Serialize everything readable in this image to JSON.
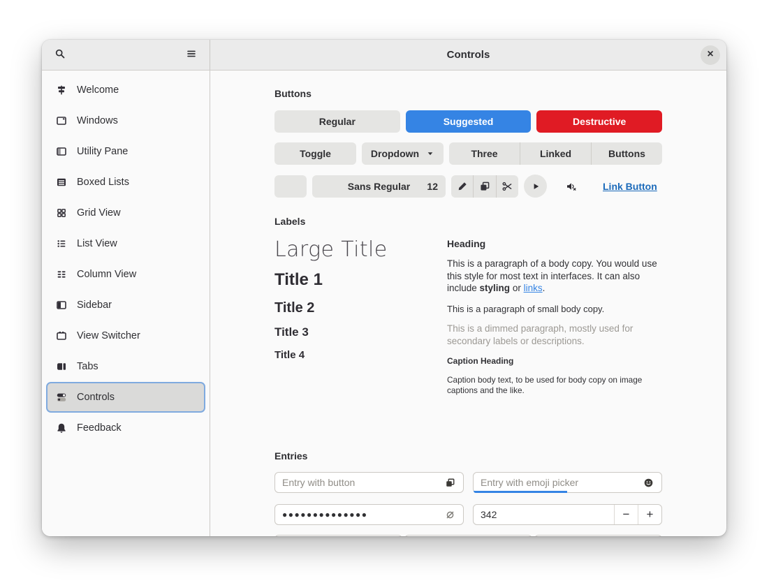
{
  "window": {
    "title": "Controls"
  },
  "titlebar": {
    "close_glyph": "×",
    "icons": [
      "search-icon",
      "hamburger-menu-icon",
      "close-icon"
    ]
  },
  "sidebar": {
    "selected": "Controls",
    "items": [
      {
        "label": "Welcome",
        "icon": "signpost-icon"
      },
      {
        "label": "Windows",
        "icon": "window-icon"
      },
      {
        "label": "Utility Pane",
        "icon": "utility-pane-icon"
      },
      {
        "label": "Boxed Lists",
        "icon": "boxed-lists-icon"
      },
      {
        "label": "Grid View",
        "icon": "grid-view-icon"
      },
      {
        "label": "List View",
        "icon": "list-view-icon"
      },
      {
        "label": "Column View",
        "icon": "column-view-icon"
      },
      {
        "label": "Sidebar",
        "icon": "sidebar-panel-icon"
      },
      {
        "label": "View Switcher",
        "icon": "view-switcher-icon"
      },
      {
        "label": "Tabs",
        "icon": "tabs-icon"
      },
      {
        "label": "Controls",
        "icon": "switch-icon"
      },
      {
        "label": "Feedback",
        "icon": "bell-icon"
      }
    ]
  },
  "sections": {
    "buttons": {
      "heading": "Buttons",
      "regular": "Regular",
      "suggested": "Suggested",
      "destructive": "Destructive",
      "toggle": "Toggle",
      "dropdown": "Dropdown",
      "linked": [
        "Three",
        "Linked",
        "Buttons"
      ],
      "font_name": "Sans Regular",
      "font_size": "12",
      "toolbar_icons": [
        "edit-pencil-icon",
        "copy-icon",
        "cut-scissors-icon",
        "play-icon",
        "volume-muted-icon"
      ],
      "link_button": "Link Button"
    },
    "labels": {
      "heading": "Labels",
      "large_title": "Large Title",
      "title1": "Title 1",
      "title2": "Title 2",
      "title3": "Title 3",
      "title4": "Title 4",
      "demo_heading": "Heading",
      "body_p1": "This is a paragraph of a body copy. You would use this style for most text in interfaces. It can also include ",
      "body_bold": "styling",
      "body_mid": " or ",
      "body_link": "links",
      "body_end": ".",
      "small_body": "This is a paragraph of small body copy.",
      "dimmed": "This is a dimmed paragraph, mostly used for secondary labels or descriptions.",
      "caption_heading": "Caption Heading",
      "caption_body": "Caption body text, to be used for body copy on image captions and the like."
    },
    "entries": {
      "heading": "Entries",
      "entry_button_placeholder": "Entry with button",
      "entry_emoji_placeholder": "Entry with emoji picker",
      "entry_icons": [
        "copy-icon",
        "emoji-smiley-icon",
        "reveal-password-icon"
      ],
      "password_value": "●●●●●●●●●●●●●●",
      "spin_value": "342",
      "minus_glyph": "−",
      "plus_glyph": "+"
    }
  },
  "colors": {
    "accent": "#3584e4",
    "destructive": "#e01b24",
    "link": "#1b6aba"
  }
}
